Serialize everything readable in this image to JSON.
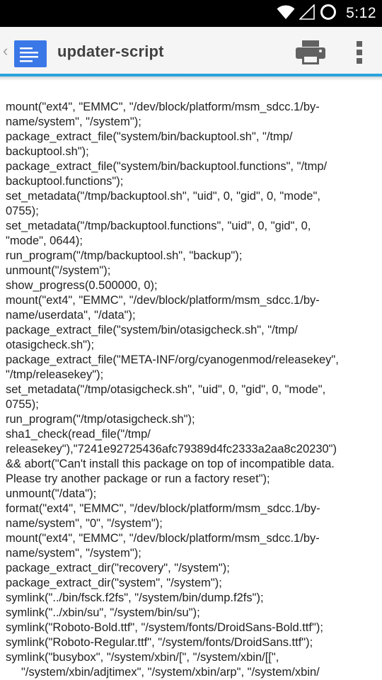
{
  "status_bar": {
    "time": "5:12",
    "icons": [
      "wifi-icon",
      "no-signal-icon",
      "sync-icon"
    ]
  },
  "app_bar": {
    "title": "updater-script",
    "icons": {
      "up": "up-chevron-icon",
      "app": "document-icon",
      "print": "print-icon",
      "overflow": "overflow-menu-icon"
    },
    "colors": {
      "accent": "#2aa3dc",
      "doc_icon": "#3b78e7"
    }
  },
  "content": {
    "lines": [
      "mount(\"ext4\", \"EMMC\", \"/dev/block/platform/msm_sdcc.1/by-",
      "name/system\", \"/system\");",
      "package_extract_file(\"system/bin/backuptool.sh\", \"/tmp/",
      "backuptool.sh\");",
      "package_extract_file(\"system/bin/backuptool.functions\", \"/tmp/",
      "backuptool.functions\");",
      "set_metadata(\"/tmp/backuptool.sh\", \"uid\", 0, \"gid\", 0, \"mode\",",
      "0755);",
      "set_metadata(\"/tmp/backuptool.functions\", \"uid\", 0, \"gid\", 0,",
      "\"mode\", 0644);",
      "run_program(\"/tmp/backuptool.sh\", \"backup\");",
      "unmount(\"/system\");",
      "show_progress(0.500000, 0);",
      "mount(\"ext4\", \"EMMC\", \"/dev/block/platform/msm_sdcc.1/by-",
      "name/userdata\", \"/data\");",
      "package_extract_file(\"system/bin/otasigcheck.sh\", \"/tmp/",
      "otasigcheck.sh\");",
      "package_extract_file(\"META-INF/org/cyanogenmod/releasekey\",",
      "\"/tmp/releasekey\");",
      "set_metadata(\"/tmp/otasigcheck.sh\", \"uid\", 0, \"gid\", 0, \"mode\",",
      "0755);",
      "run_program(\"/tmp/otasigcheck.sh\");",
      "sha1_check(read_file(\"/tmp/",
      "releasekey\"),\"7241e92725436afc79389d4fc2333a2aa8c20230\")",
      "&& abort(\"Can't install this package on top of incompatible data.",
      "Please try another package or run a factory reset\");",
      "unmount(\"/data\");",
      "format(\"ext4\", \"EMMC\", \"/dev/block/platform/msm_sdcc.1/by-",
      "name/system\", \"0\", \"/system\");",
      "mount(\"ext4\", \"EMMC\", \"/dev/block/platform/msm_sdcc.1/by-",
      "name/system\", \"/system\");",
      "package_extract_dir(\"recovery\", \"/system\");",
      "package_extract_dir(\"system\", \"/system\");",
      "symlink(\"../bin/fsck.f2fs\", \"/system/bin/dump.f2fs\");",
      "symlink(\"../xbin/su\", \"/system/bin/su\");",
      "symlink(\"Roboto-Bold.ttf\", \"/system/fonts/DroidSans-Bold.ttf\");",
      "symlink(\"Roboto-Regular.ttf\", \"/system/fonts/DroidSans.ttf\");",
      "symlink(\"busybox\", \"/system/xbin/[\", \"/system/xbin/[[\",",
      "        \"/system/xbin/adjtimex\", \"/system/xbin/arp\", \"/system/xbin/"
    ]
  }
}
